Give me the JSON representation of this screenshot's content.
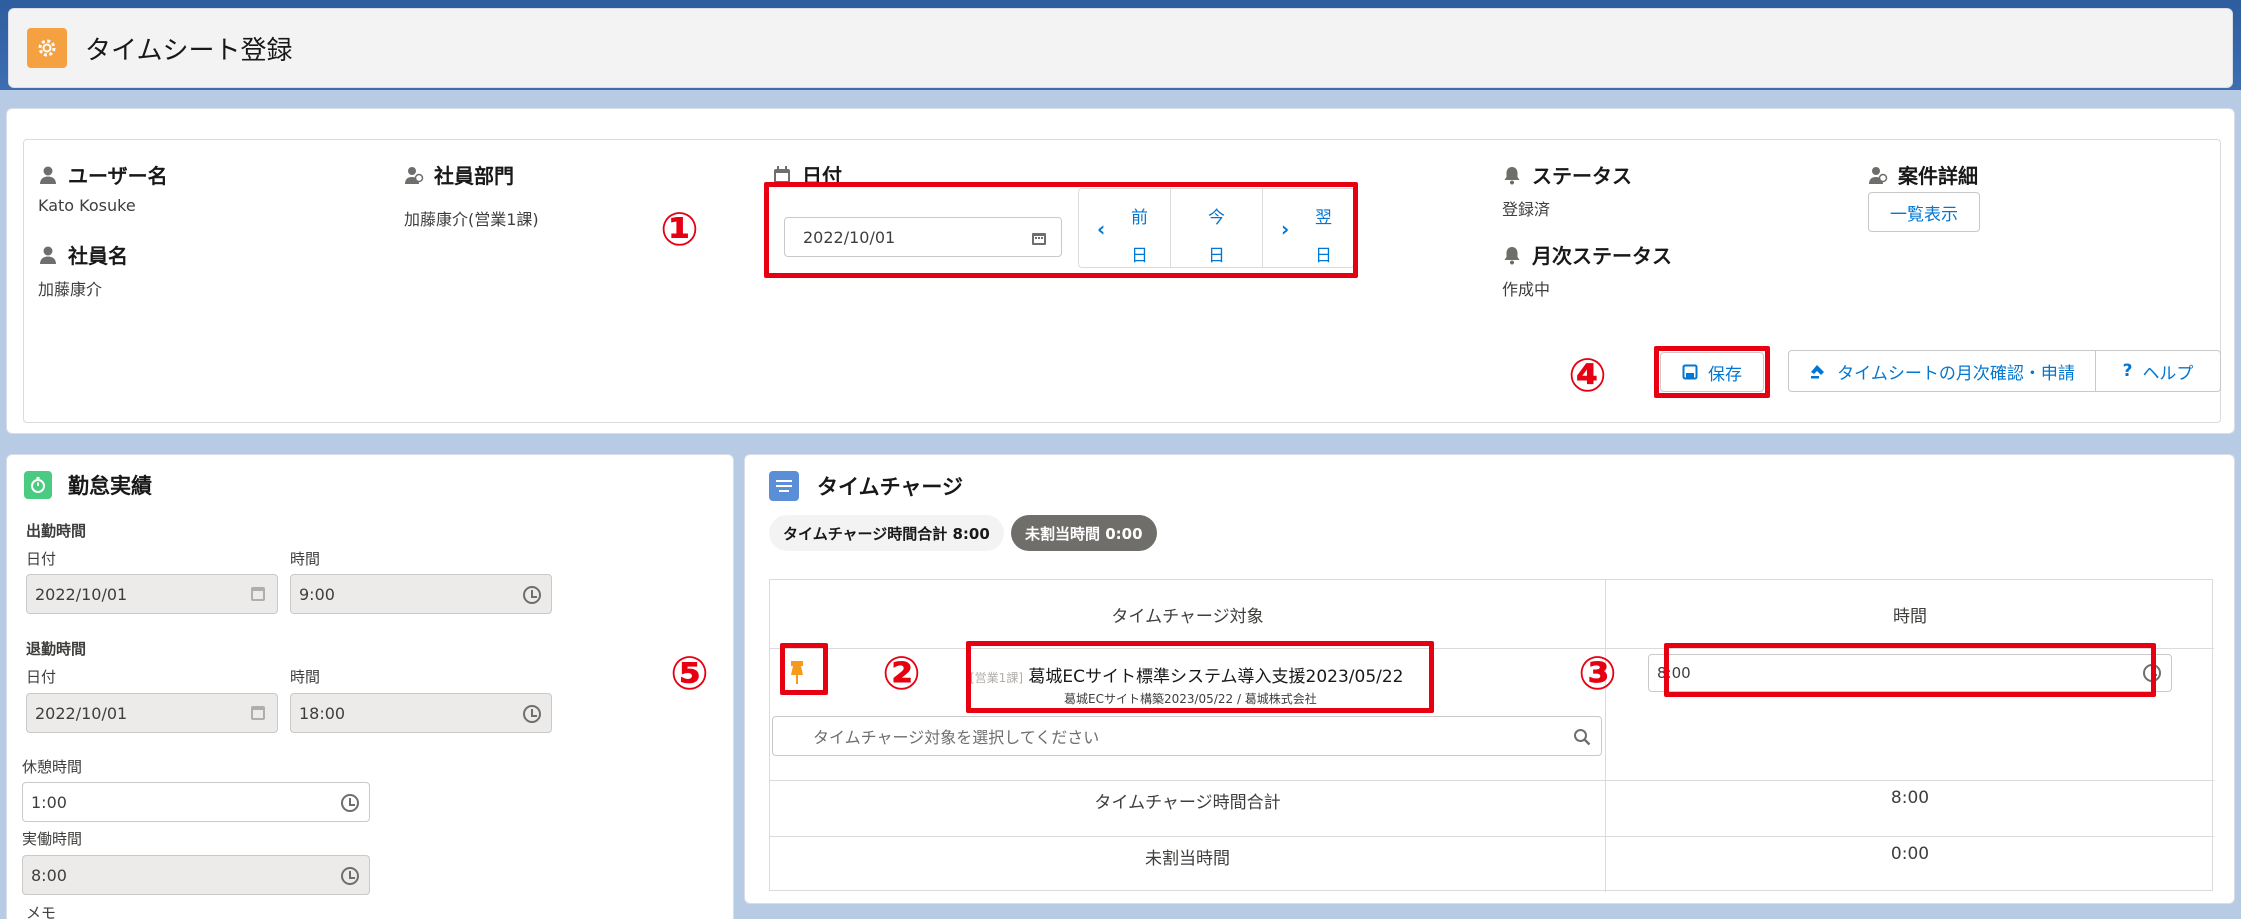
{
  "header": {
    "title": "タイムシート登録"
  },
  "info": {
    "user_label": "ユーザー名",
    "user_value": "Kato Kosuke",
    "employee_label": "社員名",
    "employee_value": "加藤康介",
    "dept_label": "社員部門",
    "dept_value": "加藤康介(営業1課)",
    "date_label": "日付",
    "date_value": "2022/10/01",
    "nav_prev": [
      "前",
      "日"
    ],
    "nav_today": [
      "今",
      "日"
    ],
    "nav_next": [
      "翌",
      "日"
    ],
    "status_label": "ステータス",
    "status_value": "登録済",
    "monthly_status_label": "月次ステータス",
    "monthly_status_value": "作成中",
    "project_label": "案件詳細",
    "project_button": "一覧表示"
  },
  "toolbar": {
    "save": "保存",
    "monthly": "タイムシートの月次確認・申請",
    "help": "ヘルプ"
  },
  "markers": [
    "①",
    "②",
    "③",
    "④",
    "⑤"
  ],
  "attendance": {
    "title": "勤怠実績",
    "clock_in_label": "出勤時間",
    "clock_out_label": "退勤時間",
    "date_label": "日付",
    "time_label": "時間",
    "clock_in_date": "2022/10/01",
    "clock_in_time": "9:00",
    "clock_out_date": "2022/10/01",
    "clock_out_time": "18:00",
    "break_label": "休憩時間",
    "break_value": "1:00",
    "actual_label": "実働時間",
    "actual_value": "8:00",
    "memo_label": "メモ"
  },
  "timecharge": {
    "title": "タイムチャージ",
    "total_pill": "タイムチャージ時間合計 8:00",
    "unassigned_pill": "未割当時間 0:00",
    "col_target": "タイムチャージ対象",
    "col_time": "時間",
    "row_prefix": "[営業1課]",
    "row_title": "葛城ECサイト標準システム導入支援2023/05/22",
    "row_sub": "葛城ECサイト構築2023/05/22 / 葛城株式会社",
    "row_time": "8:00",
    "search_placeholder": "タイムチャージ対象を選択してください",
    "total_label": "タイムチャージ時間合計",
    "total_value": "8:00",
    "unassigned_label": "未割当時間",
    "unassigned_value": "0:00"
  },
  "colors": {
    "accent": "#0176d3",
    "marker": "#e60012",
    "header_icon": "#f5a142",
    "attendance_icon": "#4bca81",
    "timecharge_icon": "#5a8fd8",
    "pin": "#f59a1b"
  }
}
